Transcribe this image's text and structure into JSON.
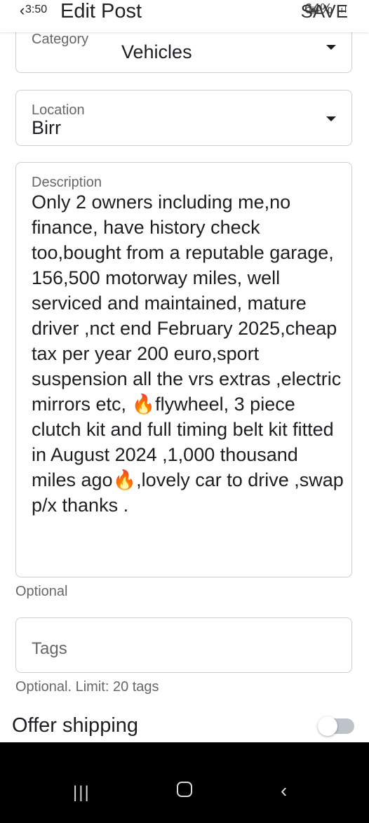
{
  "status_bar": {
    "time": "3:50",
    "battery": "64%"
  },
  "header": {
    "back_icon": "chevron-left-icon",
    "title": "Edit Post",
    "save_label": "SAVE"
  },
  "category": {
    "label": "Category",
    "value": "Vehicles"
  },
  "location": {
    "label": "Location",
    "value": "Birr"
  },
  "description": {
    "label": "Description",
    "text": "Only 2 owners including me,no finance, have history check too,bought from a reputable garage, 156,500 motorway miles, well serviced and maintained, mature driver ,nct end February 2025,cheap tax per year 200 euro,sport suspension all the vrs extras ,electric mirrors etc, 🔥flywheel, 3 piece clutch kit and full timing belt kit fitted in August 2024 ,1,000 thousand miles ago🔥,lovely car to drive ,swap p/x thanks .",
    "helper": "Optional"
  },
  "tags": {
    "placeholder": "Tags",
    "helper": "Optional. Limit: 20 tags"
  },
  "shipping": {
    "label": "Offer shipping",
    "enabled": false
  },
  "nav": {
    "recents_icon": "recents-icon",
    "home_icon": "home-icon",
    "back_icon": "back-icon"
  }
}
